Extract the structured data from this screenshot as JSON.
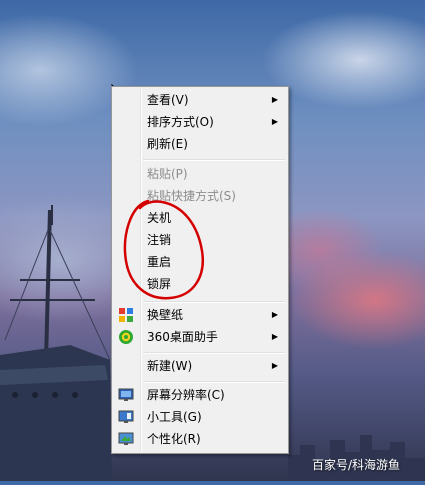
{
  "menu": {
    "items": [
      {
        "label": "查看(V)",
        "submenu": true,
        "disabled": false,
        "icon": null
      },
      {
        "label": "排序方式(O)",
        "submenu": true,
        "disabled": false,
        "icon": null
      },
      {
        "label": "刷新(E)",
        "submenu": false,
        "disabled": false,
        "icon": null
      },
      {
        "label": "粘贴(P)",
        "submenu": false,
        "disabled": true,
        "icon": null
      },
      {
        "label": "粘贴快捷方式(S)",
        "submenu": false,
        "disabled": true,
        "icon": null
      },
      {
        "label": "关机",
        "submenu": false,
        "disabled": false,
        "icon": null
      },
      {
        "label": "注销",
        "submenu": false,
        "disabled": false,
        "icon": null
      },
      {
        "label": "重启",
        "submenu": false,
        "disabled": false,
        "icon": null
      },
      {
        "label": "锁屏",
        "submenu": false,
        "disabled": false,
        "icon": null
      },
      {
        "label": "换壁纸",
        "submenu": true,
        "disabled": false,
        "icon": "wallpaper-change-icon"
      },
      {
        "label": "360桌面助手",
        "submenu": true,
        "disabled": false,
        "icon": "desktop-assistant-360-icon"
      },
      {
        "label": "新建(W)",
        "submenu": true,
        "disabled": false,
        "icon": null
      },
      {
        "label": "屏幕分辨率(C)",
        "submenu": false,
        "disabled": false,
        "icon": "screen-resolution-icon"
      },
      {
        "label": "小工具(G)",
        "submenu": false,
        "disabled": false,
        "icon": "gadgets-icon"
      },
      {
        "label": "个性化(R)",
        "submenu": false,
        "disabled": false,
        "icon": "personalize-icon"
      }
    ]
  },
  "watermark": "百家号/科海游鱼",
  "colors": {
    "menu_background": "#f0f0f0",
    "menu_border": "#979797",
    "disabled_text": "#8d8d8d",
    "annotation_red": "#d40000"
  }
}
